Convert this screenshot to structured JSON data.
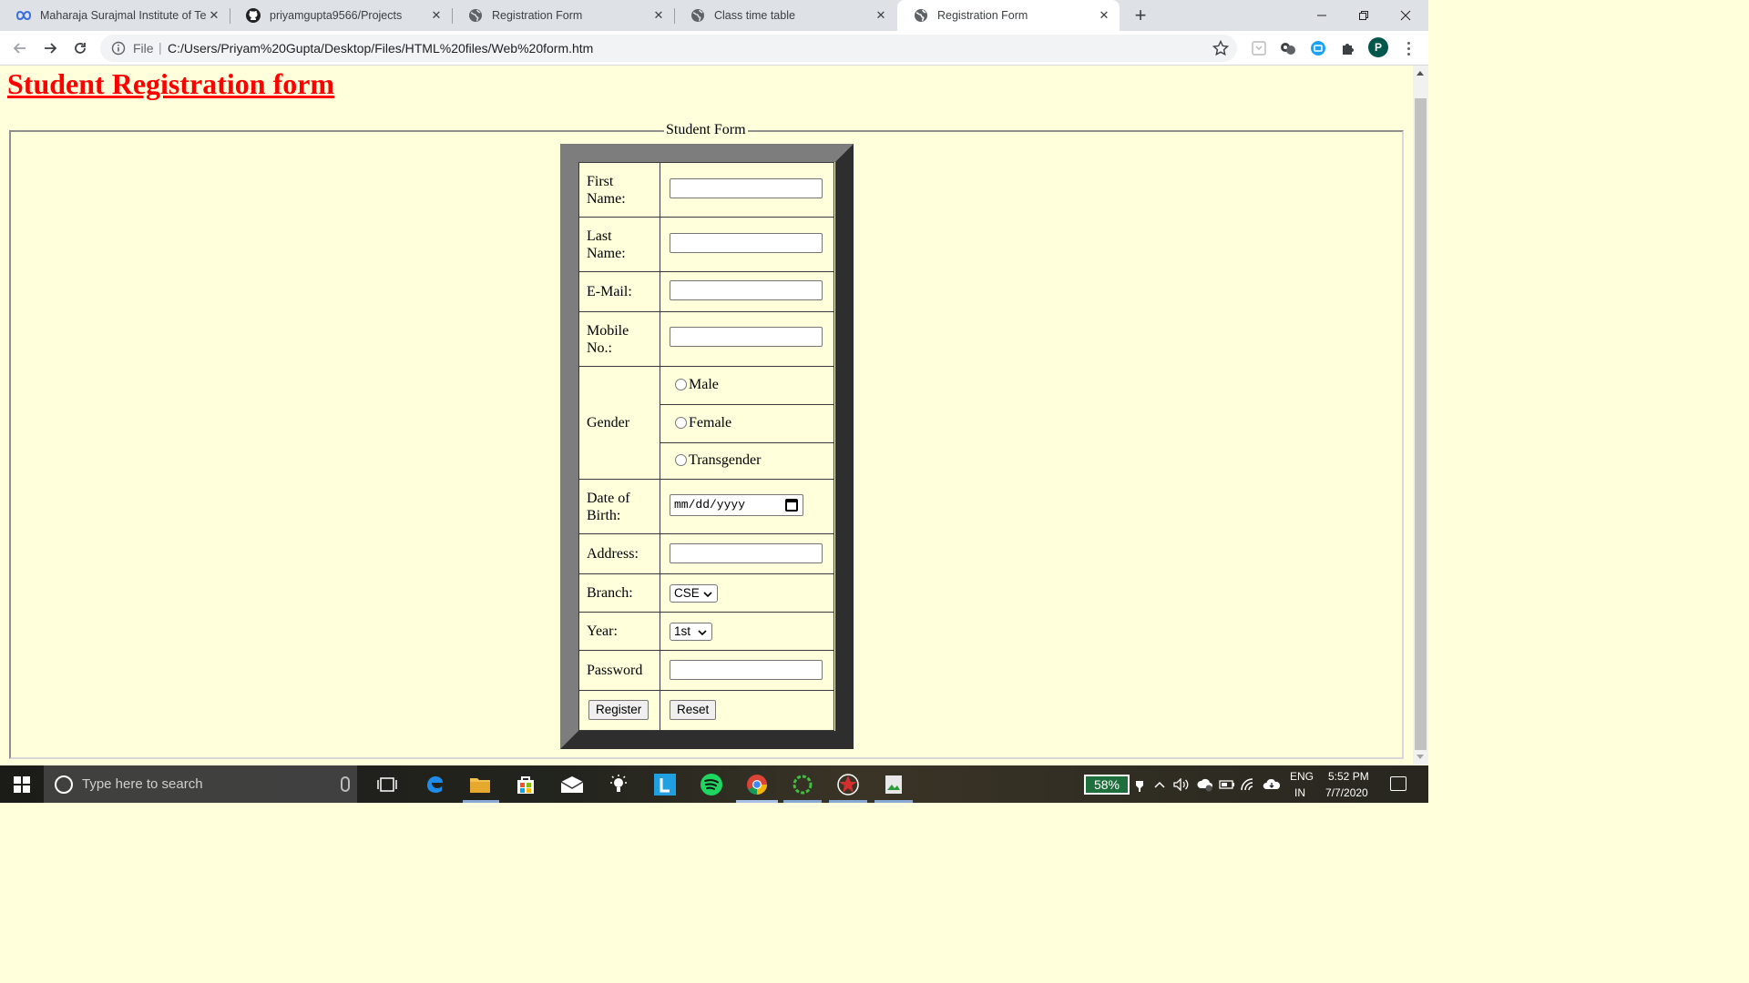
{
  "browser": {
    "tabs": [
      {
        "title": "Maharaja Surajmal Institute of Te",
        "icon": "infinity-icon",
        "active": false
      },
      {
        "title": "priyamgupta9566/Projects",
        "icon": "github-icon",
        "active": false
      },
      {
        "title": "Registration Form",
        "icon": "globe-icon",
        "active": false
      },
      {
        "title": "Class time table",
        "icon": "globe-icon",
        "active": false
      },
      {
        "title": "Registration Form",
        "icon": "globe-icon",
        "active": true
      }
    ],
    "close_glyph": "✕",
    "new_tab_glyph": "+",
    "address": {
      "scheme_label": "File",
      "separator": "|",
      "url": "C:/Users/Priyam%20Gupta/Desktop/Files/HTML%20files/Web%20form.htm"
    },
    "profile_initial": "P"
  },
  "page": {
    "heading": "Student Registration form",
    "legend": "Student Form",
    "fields": {
      "first_name": {
        "label": "First Name:",
        "value": ""
      },
      "last_name": {
        "label": "Last Name:",
        "value": ""
      },
      "email": {
        "label": "E-Mail:",
        "value": ""
      },
      "mobile": {
        "label": "Mobile No.:",
        "value": ""
      },
      "gender": {
        "label": "Gender",
        "options": [
          "Male",
          "Female",
          "Transgender"
        ],
        "selected": null
      },
      "dob": {
        "label": "Date of Birth:",
        "placeholder": "mm/dd/yyyy"
      },
      "address": {
        "label": "Address:",
        "value": ""
      },
      "branch": {
        "label": "Branch:",
        "selected": "CSE"
      },
      "year": {
        "label": "Year:",
        "selected": "1st"
      },
      "password": {
        "label": "Password",
        "value": ""
      }
    },
    "buttons": {
      "register": "Register",
      "reset": "Reset"
    }
  },
  "taskbar": {
    "search_placeholder": "Type here to search",
    "apps": [
      "task-view-icon",
      "edge-icon",
      "file-explorer-icon",
      "store-icon",
      "mail-icon",
      "tips-icon",
      "l-app-icon",
      "spotify-icon",
      "chrome-icon",
      "green-ring-app-icon",
      "red-star-app-icon",
      "green-app-icon"
    ],
    "battery_percent": "58%",
    "language": {
      "line1": "ENG",
      "line2": "IN"
    },
    "time": "5:52 PM",
    "date": "7/7/2020"
  },
  "colors": {
    "page_background": "#ffffdb",
    "heading": "#ff0000",
    "tab_strip": "#dee1e6",
    "table_border_light": "#7d7d7d",
    "table_border_dark": "#2e2e2e"
  }
}
